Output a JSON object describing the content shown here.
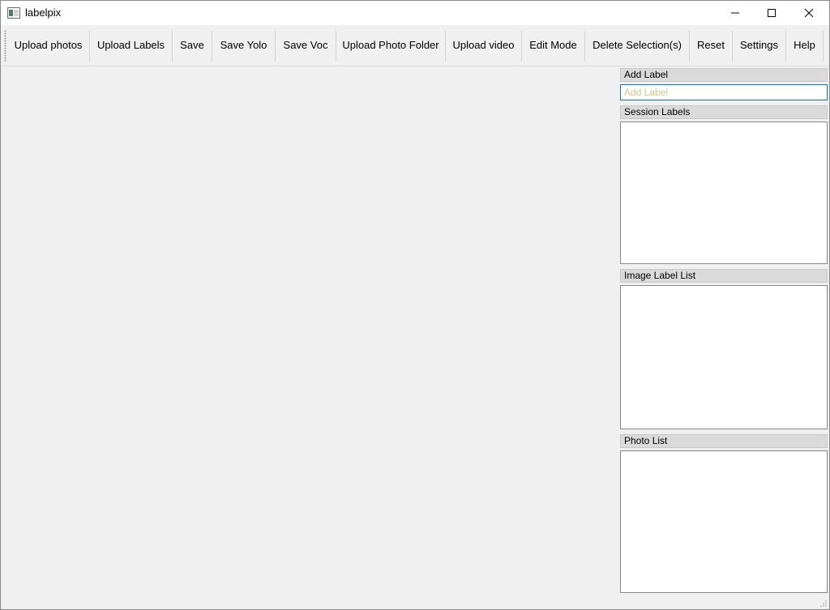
{
  "window": {
    "title": "labelpix",
    "icons": {
      "app": "app-window-icon",
      "minimize": "minimize-icon",
      "maximize": "maximize-icon",
      "close": "close-icon"
    }
  },
  "toolbar": {
    "items": [
      {
        "id": "upload-photos",
        "label": "Upload photos"
      },
      {
        "id": "upload-labels",
        "label": "Upload Labels"
      },
      {
        "id": "save",
        "label": "Save"
      },
      {
        "id": "save-yolo",
        "label": "Save Yolo"
      },
      {
        "id": "save-voc",
        "label": "Save Voc"
      },
      {
        "id": "upload-photo-folder",
        "label": "Upload Photo Folder"
      },
      {
        "id": "upload-video",
        "label": "Upload video"
      },
      {
        "id": "edit-mode",
        "label": "Edit Mode"
      },
      {
        "id": "delete-selections",
        "label": "Delete Selection(s)"
      },
      {
        "id": "reset",
        "label": "Reset"
      },
      {
        "id": "settings",
        "label": "Settings"
      },
      {
        "id": "help",
        "label": "Help"
      }
    ]
  },
  "side_panel": {
    "add_label": {
      "title": "Add Label",
      "placeholder": "Add Label",
      "value": ""
    },
    "session_labels": {
      "title": "Session Labels",
      "items": []
    },
    "image_label_list": {
      "title": "Image Label List",
      "items": []
    },
    "photo_list": {
      "title": "Photo List",
      "items": []
    }
  },
  "colors": {
    "accent": "#0078d7",
    "placeholder": "#d8c48a",
    "background": "#f0f0f0"
  }
}
